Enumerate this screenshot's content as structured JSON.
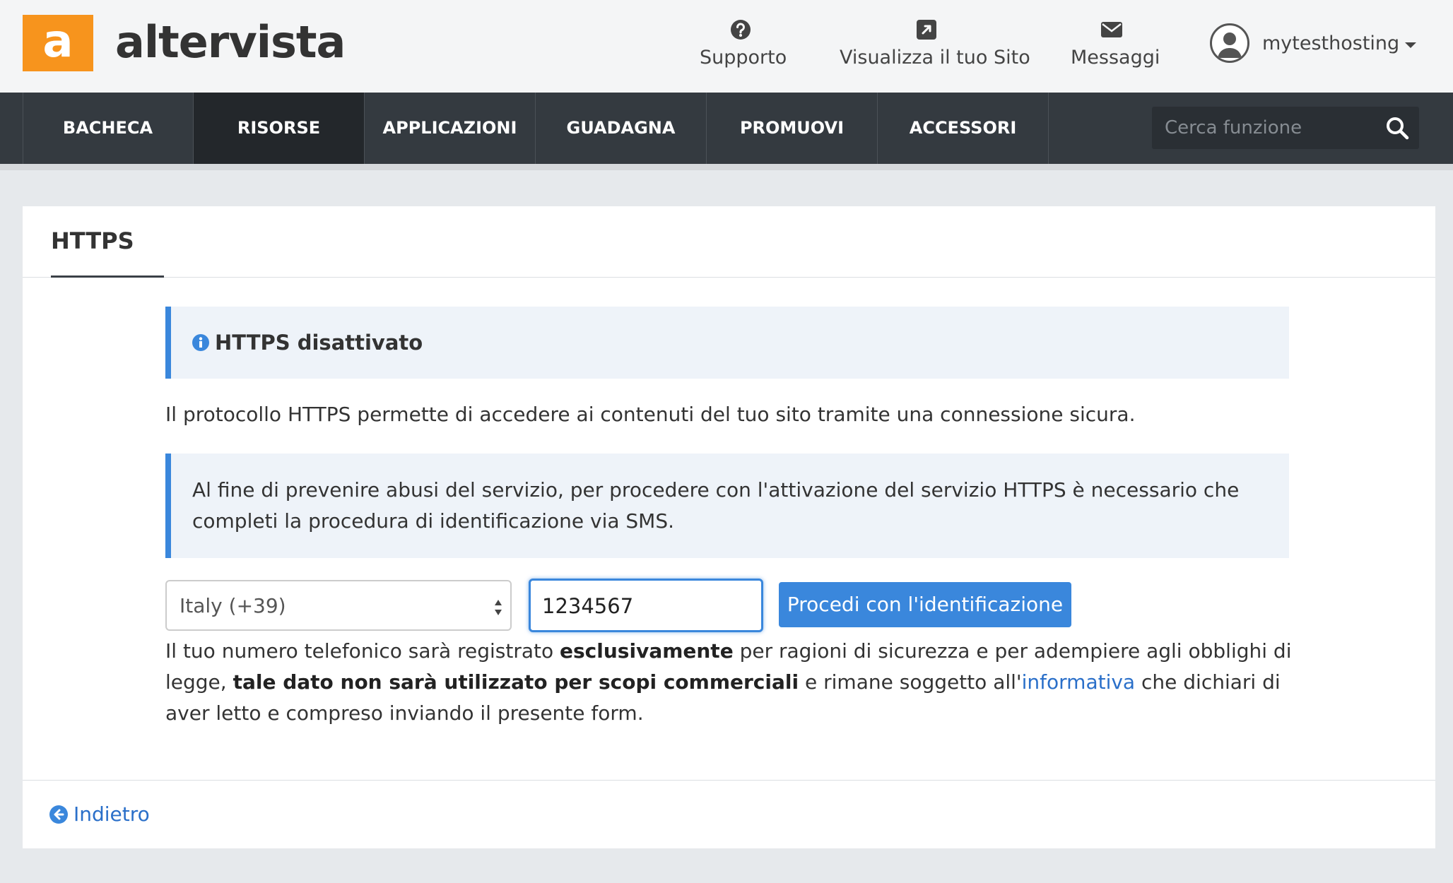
{
  "brand": {
    "logo_letter": "a",
    "name": "altervista",
    "accent": "#f7941d"
  },
  "header": {
    "support_label": "Supporto",
    "view_site_label": "Visualizza il tuo Sito",
    "messages_label": "Messaggi",
    "username": "mytesthosting"
  },
  "nav": {
    "items": [
      {
        "label": "BACHECA",
        "active": false
      },
      {
        "label": "RISORSE",
        "active": true
      },
      {
        "label": "APPLICAZIONI",
        "active": false
      },
      {
        "label": "GUADAGNA",
        "active": false
      },
      {
        "label": "PROMUOVI",
        "active": false
      },
      {
        "label": "ACCESSORI",
        "active": false
      }
    ],
    "search_placeholder": "Cerca funzione"
  },
  "panel": {
    "title": "HTTPS",
    "status_alert": "HTTPS disattivato",
    "description": "Il protocollo HTTPS permette di accedere ai contenuti del tuo sito tramite una connessione sicura.",
    "sms_notice": "Al fine di prevenire abusi del servizio, per procedere con l'attivazione del servizio HTTPS è necessario che completi la procedura di identificazione via SMS.",
    "country_select": "Italy (+39)",
    "phone_value": "1234567",
    "submit_label": "Procedi con l'identificazione",
    "legal": {
      "p1": "Il tuo numero telefonico sarà registrato ",
      "b1": "esclusivamente",
      "p2": " per ragioni di sicurezza e per adempiere agli obblighi di legge, ",
      "b2": "tale dato non sarà utilizzato per scopi commerciali",
      "p3": " e rimane soggetto all'",
      "link": "informativa",
      "p4": " che dichiari di aver letto e compreso inviando il presente form."
    },
    "back_label": "Indietro"
  },
  "colors": {
    "primary": "#3a87dc",
    "nav_bg": "#343a40",
    "nav_active": "#23272b"
  }
}
